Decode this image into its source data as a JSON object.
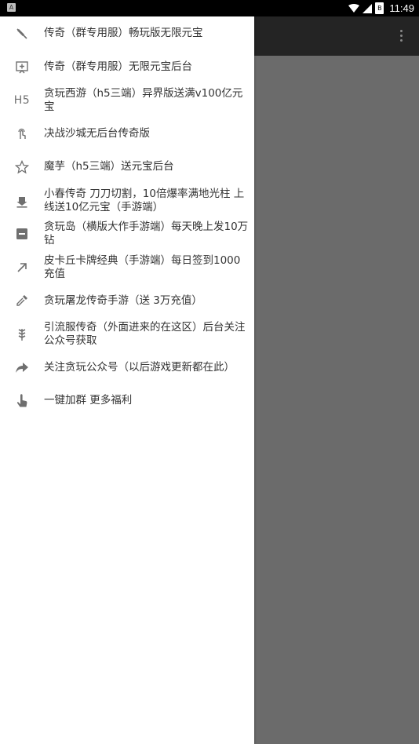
{
  "status_bar": {
    "notification_glyph": "A",
    "battery_glyph": "B",
    "time": "11:49"
  },
  "drawer": {
    "items": [
      {
        "label": "传奇（群专用服）畅玩版无限元宝",
        "icon": "brush-off-icon"
      },
      {
        "label": "传奇（群专用服）无限元宝后台",
        "icon": "add-box-icon"
      },
      {
        "label": "贪玩西游（h5三端）异界版送满v100亿元宝",
        "icon_text": "H5"
      },
      {
        "label": "决战沙城无后台传奇版",
        "icon": "touch-icon"
      },
      {
        "label": "魔芋（h5三端）送元宝后台",
        "icon": "star-outline-icon"
      },
      {
        "label": "小春传奇 刀刀切割，10倍爆率满地光柱 上线送10亿元宝（手游端）",
        "icon": "download-icon"
      },
      {
        "label": "贪玩岛（横版大作手游端）每天晚上发10万钻",
        "icon": "minus-box-icon"
      },
      {
        "label": "皮卡丘卡牌经典（手游端）每日签到1000充值",
        "icon": "arrow-up-right-icon"
      },
      {
        "label": "贪玩屠龙传奇手游（送 3万充值）",
        "icon": "dropper-icon"
      },
      {
        "label": "引流服传奇（外面进来的在这区）后台关注公众号获取",
        "icon": "grain-icon"
      },
      {
        "label": "关注贪玩公众号（以后游戏更新都在此）",
        "icon": "share-arrow-icon"
      },
      {
        "label": "一键加群 更多福利",
        "icon": "pointer-hand-icon"
      }
    ]
  }
}
